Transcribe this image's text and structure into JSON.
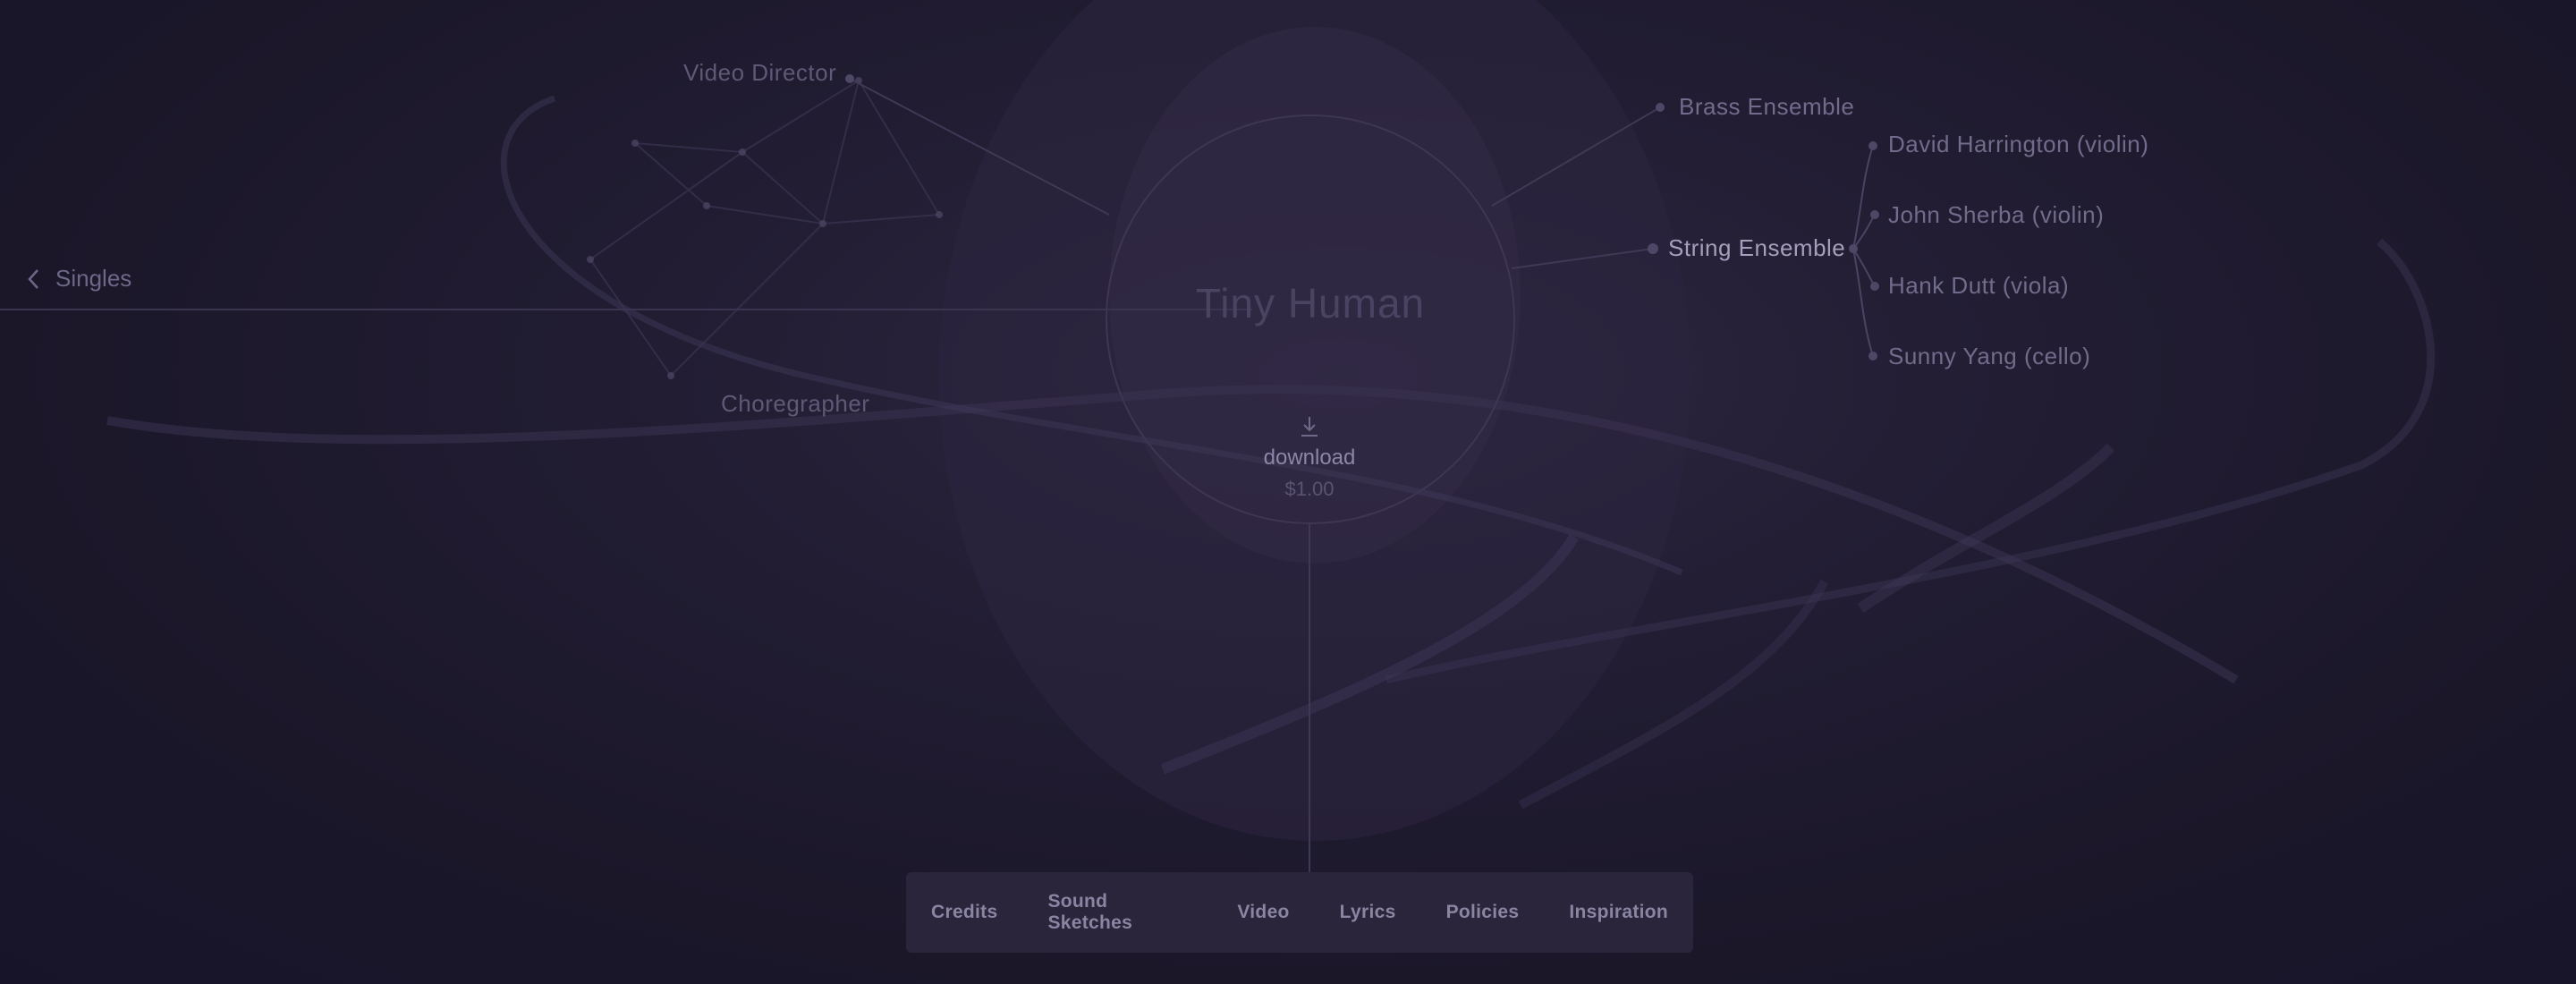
{
  "nav": {
    "back_label": "Singles"
  },
  "song": {
    "title": "Tiny Human"
  },
  "download": {
    "label": "download",
    "price": "$1.00"
  },
  "credits": {
    "video_director": "Video Director",
    "choregrapher": "Choregrapher",
    "brass_ensemble": "Brass Ensemble",
    "string_ensemble": "String Ensemble",
    "string_members": [
      "David Harrington (violin)",
      "John Sherba (violin)",
      "Hank Dutt (viola)",
      "Sunny Yang (cello)"
    ]
  },
  "tabs": [
    "Credits",
    "Sound Sketches",
    "Video",
    "Lyrics",
    "Policies",
    "Inspiration"
  ],
  "colors": {
    "background": "#1b1729",
    "tab_bar": "#2a253b",
    "text_bright": "#a49fbd",
    "text_dim": "#5f5977"
  }
}
